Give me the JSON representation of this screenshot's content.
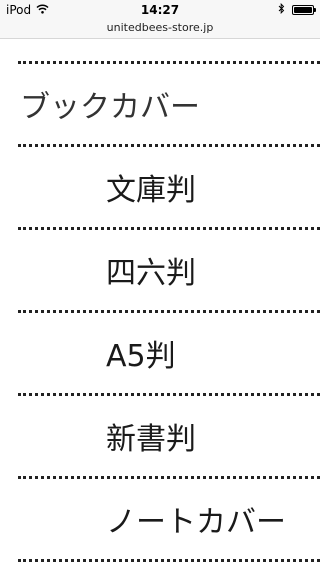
{
  "status_bar": {
    "carrier": "iPod",
    "time": "14:27",
    "wifi_icon": "wifi-icon",
    "bluetooth_icon": "bluetooth-icon",
    "battery_level": 1.0
  },
  "browser": {
    "url": "unitedbees-store.jp"
  },
  "menu": {
    "heading": "ブックカバー",
    "items": [
      {
        "label": "文庫判"
      },
      {
        "label": "四六判"
      },
      {
        "label": "A5判"
      },
      {
        "label": "新書判"
      },
      {
        "label": "ノートカバー"
      }
    ]
  }
}
